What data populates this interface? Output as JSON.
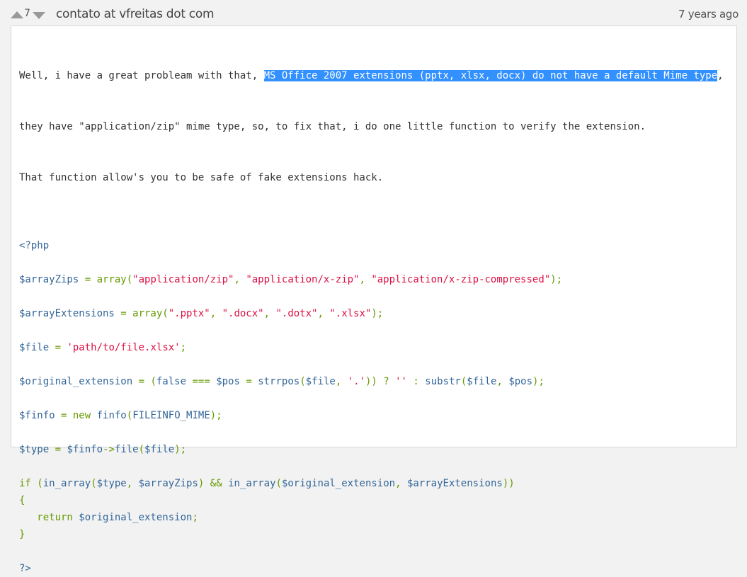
{
  "header": {
    "vote_count": "7",
    "author": "contato at vfreitas dot com",
    "date": "7 years ago"
  },
  "note": {
    "text_lines": [
      {
        "before": "Well, i have a great probleam with that, ",
        "selected": "MS Office 2007 extensions (pptx, xlsx, docx) do not have a default Mime type",
        "after": ","
      },
      {
        "before": "they have \"application/zip\" mime type, so, to fix that, i do one little function to verify the extension.",
        "selected": "",
        "after": ""
      },
      {
        "before": "That function allow's you to be safe of fake extensions hack.",
        "selected": "",
        "after": ""
      }
    ],
    "code_lines": [
      [],
      [
        [
          "v",
          "<?php"
        ]
      ],
      [],
      [
        [
          "v",
          "$arrayZips"
        ],
        [
          "k",
          " = array("
        ],
        [
          "s",
          "\"application/zip\""
        ],
        [
          "k",
          ", "
        ],
        [
          "s",
          "\"application/x-zip\""
        ],
        [
          "k",
          ", "
        ],
        [
          "s",
          "\"application/x-zip-compressed\""
        ],
        [
          "k",
          ");"
        ]
      ],
      [],
      [
        [
          "v",
          "$arrayExtensions"
        ],
        [
          "k",
          " = array("
        ],
        [
          "s",
          "\".pptx\""
        ],
        [
          "k",
          ", "
        ],
        [
          "s",
          "\".docx\""
        ],
        [
          "k",
          ", "
        ],
        [
          "s",
          "\".dotx\""
        ],
        [
          "k",
          ", "
        ],
        [
          "s",
          "\".xlsx\""
        ],
        [
          "k",
          ");"
        ]
      ],
      [],
      [
        [
          "v",
          "$file"
        ],
        [
          "k",
          " = "
        ],
        [
          "s",
          "'path/to/file.xlsx'"
        ],
        [
          "k",
          ";"
        ]
      ],
      [],
      [
        [
          "v",
          "$original_extension"
        ],
        [
          "k",
          " = ("
        ],
        [
          "v",
          "false"
        ],
        [
          "k",
          " === "
        ],
        [
          "v",
          "$pos"
        ],
        [
          "k",
          " = "
        ],
        [
          "v",
          "strrpos"
        ],
        [
          "k",
          "("
        ],
        [
          "v",
          "$file"
        ],
        [
          "k",
          ", "
        ],
        [
          "s",
          "'.'"
        ],
        [
          "k",
          ")) ? "
        ],
        [
          "s",
          "''"
        ],
        [
          "k",
          " : "
        ],
        [
          "v",
          "substr"
        ],
        [
          "k",
          "("
        ],
        [
          "v",
          "$file"
        ],
        [
          "k",
          ", "
        ],
        [
          "v",
          "$pos"
        ],
        [
          "k",
          ");"
        ]
      ],
      [],
      [
        [
          "v",
          "$finfo"
        ],
        [
          "k",
          " = new "
        ],
        [
          "v",
          "finfo"
        ],
        [
          "k",
          "("
        ],
        [
          "v",
          "FILEINFO_MIME"
        ],
        [
          "k",
          ");"
        ]
      ],
      [],
      [
        [
          "v",
          "$type"
        ],
        [
          "k",
          " = "
        ],
        [
          "v",
          "$finfo"
        ],
        [
          "k",
          "->"
        ],
        [
          "v",
          "file"
        ],
        [
          "k",
          "("
        ],
        [
          "v",
          "$file"
        ],
        [
          "k",
          ");"
        ]
      ],
      [],
      [
        [
          "k",
          "if ("
        ],
        [
          "v",
          "in_array"
        ],
        [
          "k",
          "("
        ],
        [
          "v",
          "$type"
        ],
        [
          "k",
          ", "
        ],
        [
          "v",
          "$arrayZips"
        ],
        [
          "k",
          ") && "
        ],
        [
          "v",
          "in_array"
        ],
        [
          "k",
          "("
        ],
        [
          "v",
          "$original_extension"
        ],
        [
          "k",
          ", "
        ],
        [
          "v",
          "$arrayExtensions"
        ],
        [
          "k",
          "))"
        ]
      ],
      [
        [
          "k",
          "{"
        ]
      ],
      [
        [
          "k",
          "   return "
        ],
        [
          "v",
          "$original_extension"
        ],
        [
          "k",
          ";"
        ]
      ],
      [
        [
          "k",
          "}"
        ]
      ],
      [],
      [
        [
          "v",
          "?>"
        ]
      ]
    ]
  },
  "colors": {
    "variable": "#336699",
    "keyword": "#669900",
    "string": "#dd1144",
    "selection": "#3390ff"
  }
}
